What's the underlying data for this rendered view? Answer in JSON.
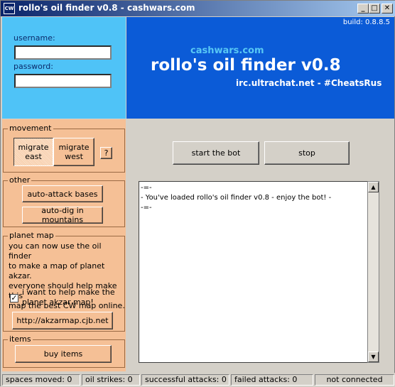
{
  "window": {
    "title": "rollo's oil finder v0.8 - cashwars.com",
    "icon_text": "CW",
    "minimize_glyph": "_",
    "maximize_glyph": "□",
    "close_glyph": "✕"
  },
  "login": {
    "username_label": "username:",
    "username_value": "",
    "password_label": "password:",
    "password_value": ""
  },
  "banner": {
    "build": "build: 0.8.8.5",
    "site": "cashwars.com",
    "title": "rollo's oil finder v0.8",
    "irc": "irc.ultrachat.net - #CheatsRus"
  },
  "movement": {
    "legend": "movement",
    "east_line1": "migrate",
    "east_line2": "east",
    "west_line1": "migrate",
    "west_line2": "west",
    "help_label": "?"
  },
  "other": {
    "legend": "other",
    "auto_attack": "auto-attack bases",
    "auto_dig": "auto-dig in mountains"
  },
  "planet_map": {
    "legend": "planet map",
    "text_lines": [
      "you can now use the oil finder",
      "to make a map of planet akzar.",
      "everyone should help make this",
      "map the best CW map online."
    ],
    "checkbox_checked": true,
    "checkbox_mark": "✓",
    "checkbox_line1": "i want to help make the",
    "checkbox_line2": "planet akzar map!",
    "link_button": "http://akzarmap.cjb.net"
  },
  "items": {
    "legend": "items",
    "buy_button": "buy items"
  },
  "controls": {
    "start": "start the bot",
    "stop": "stop"
  },
  "log": {
    "lines": [
      "-=-",
      "- You've loaded rollo's oil finder v0.8 - enjoy the bot! -",
      "-=-"
    ],
    "scroll_up": "▲",
    "scroll_down": "▼"
  },
  "status": {
    "spaces_moved": "spaces moved: 0",
    "oil_strikes": "oil strikes: 0",
    "successful_attacks": "successful attacks: 0",
    "failed_attacks": "failed attacks: 0",
    "connection": "not connected"
  }
}
